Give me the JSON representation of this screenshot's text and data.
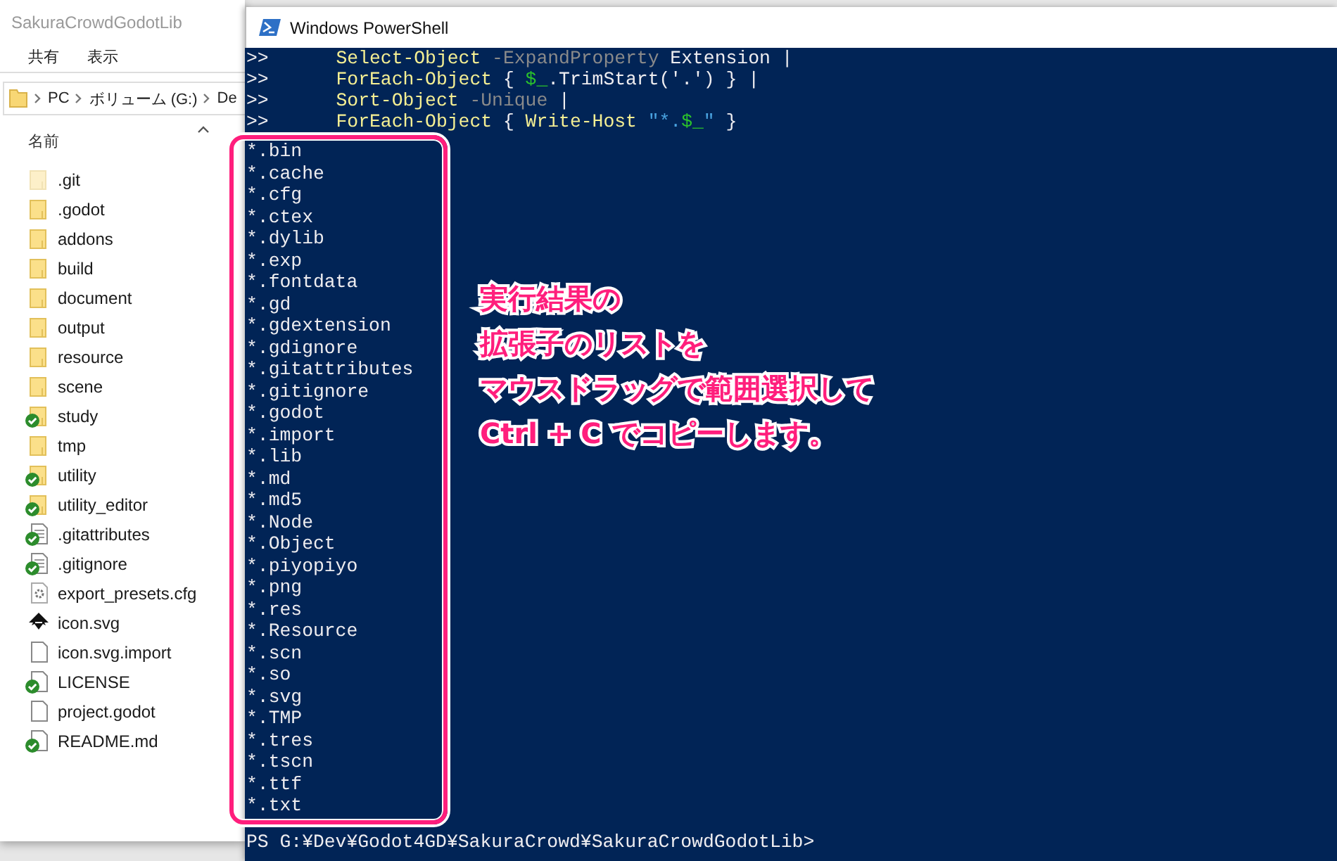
{
  "explorer": {
    "title": "SakuraCrowdGodotLib",
    "ribbon_tabs": [
      "共有",
      "表示"
    ],
    "breadcrumb": [
      "PC",
      "ボリューム (G:)",
      "De"
    ],
    "column_header": "名前",
    "files": [
      {
        "name": ".git",
        "kind": "hidden_folder",
        "synced": false
      },
      {
        "name": ".godot",
        "kind": "folder",
        "synced": false
      },
      {
        "name": "addons",
        "kind": "folder",
        "synced": false
      },
      {
        "name": "build",
        "kind": "folder",
        "synced": false
      },
      {
        "name": "document",
        "kind": "folder",
        "synced": false
      },
      {
        "name": "output",
        "kind": "folder",
        "synced": false
      },
      {
        "name": "resource",
        "kind": "folder",
        "synced": false
      },
      {
        "name": "scene",
        "kind": "folder",
        "synced": false
      },
      {
        "name": "study",
        "kind": "folder",
        "synced": true
      },
      {
        "name": "tmp",
        "kind": "folder",
        "synced": false
      },
      {
        "name": "utility",
        "kind": "folder",
        "synced": true
      },
      {
        "name": "utility_editor",
        "kind": "folder",
        "synced": true
      },
      {
        "name": ".gitattributes",
        "kind": "text",
        "synced": true
      },
      {
        "name": ".gitignore",
        "kind": "text",
        "synced": true
      },
      {
        "name": "export_presets.cfg",
        "kind": "config",
        "synced": false
      },
      {
        "name": "icon.svg",
        "kind": "vector",
        "synced": false
      },
      {
        "name": "icon.svg.import",
        "kind": "file",
        "synced": false
      },
      {
        "name": "LICENSE",
        "kind": "file",
        "synced": true
      },
      {
        "name": "project.godot",
        "kind": "file",
        "synced": false
      },
      {
        "name": "README.md",
        "kind": "file",
        "synced": true
      }
    ]
  },
  "powershell": {
    "title": "Windows PowerShell",
    "commands": [
      {
        "prompt": ">>",
        "segments": [
          {
            "kind": "cmd",
            "text": "Select-Object"
          },
          {
            "kind": "param",
            "text": " -ExpandProperty"
          },
          {
            "kind": "plain",
            "text": " Extension |"
          }
        ]
      },
      {
        "prompt": ">>",
        "segments": [
          {
            "kind": "cmd",
            "text": "ForEach-Object"
          },
          {
            "kind": "plain",
            "text": " { "
          },
          {
            "kind": "var",
            "text": "$_"
          },
          {
            "kind": "plain",
            "text": ".TrimStart('.') } |"
          }
        ]
      },
      {
        "prompt": ">>",
        "segments": [
          {
            "kind": "cmd",
            "text": "Sort-Object"
          },
          {
            "kind": "param",
            "text": " -Unique"
          },
          {
            "kind": "plain",
            "text": " |"
          }
        ]
      },
      {
        "prompt": ">>",
        "segments": [
          {
            "kind": "cmd",
            "text": "ForEach-Object"
          },
          {
            "kind": "plain",
            "text": " { "
          },
          {
            "kind": "cmd",
            "text": "Write-Host"
          },
          {
            "kind": "string",
            "text": " \"*."
          },
          {
            "kind": "var",
            "text": "$_"
          },
          {
            "kind": "string",
            "text": "\""
          },
          {
            "kind": "plain",
            "text": " }"
          }
        ]
      }
    ],
    "output": [
      "*.bin",
      "*.cache",
      "*.cfg",
      "*.ctex",
      "*.dylib",
      "*.exp",
      "*.fontdata",
      "*.gd",
      "*.gdextension",
      "*.gdignore",
      "*.gitattributes",
      "*.gitignore",
      "*.godot",
      "*.import",
      "*.lib",
      "*.md",
      "*.md5",
      "*.Node",
      "*.Object",
      "*.piyopiyo",
      "*.png",
      "*.res",
      "*.Resource",
      "*.scn",
      "*.so",
      "*.svg",
      "*.TMP",
      "*.tres",
      "*.tscn",
      "*.ttf",
      "*.txt"
    ],
    "final_prompt": "PS G:¥Dev¥Godot4GD¥SakuraCrowd¥SakuraCrowdGodotLib>"
  },
  "annotation": [
    "実行結果の",
    "拡張子のリストを",
    "マウスドラッグで範囲選択して",
    "Ctrl + C でコピーします。"
  ]
}
